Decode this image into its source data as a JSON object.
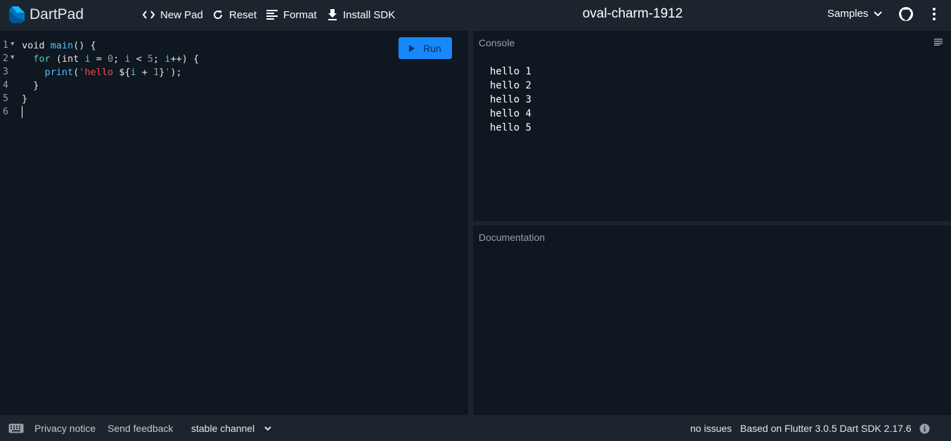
{
  "app": {
    "name": "DartPad",
    "pad_title": "oval-charm-1912"
  },
  "toolbar": {
    "new_pad": "New Pad",
    "reset": "Reset",
    "format": "Format",
    "install_sdk": "Install SDK",
    "samples": "Samples"
  },
  "editor": {
    "run_label": "Run",
    "line_numbers": [
      "1",
      "2",
      "3",
      "4",
      "5",
      "6"
    ]
  },
  "console": {
    "title": "Console",
    "lines": [
      "hello 1",
      "hello 2",
      "hello 3",
      "hello 4",
      "hello 5"
    ]
  },
  "documentation": {
    "title": "Documentation"
  },
  "footer": {
    "privacy": "Privacy notice",
    "feedback": "Send feedback",
    "channel": "stable channel",
    "issues": "no issues",
    "sdk_info": "Based on Flutter 3.0.5 Dart SDK 2.17.6"
  },
  "icons": {
    "new_pad": "code-brackets-icon",
    "reset": "refresh-icon",
    "format": "format-lines-icon",
    "install_sdk": "download-icon",
    "github": "github-icon",
    "more": "more-vert-icon",
    "keyboard": "keyboard-icon",
    "info": "info-icon",
    "clear": "clear-console-icon"
  },
  "colors": {
    "accent": "#168afd",
    "background": "#0f1720",
    "chrome": "#1c252e",
    "string": "#f14c5a",
    "identifier": "#4fc1ff"
  }
}
